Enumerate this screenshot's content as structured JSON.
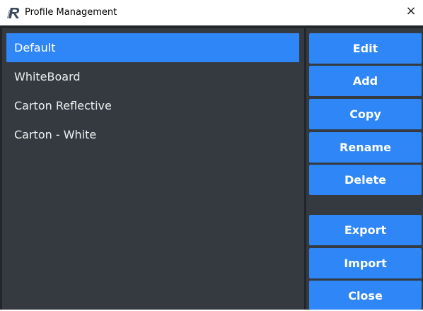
{
  "window": {
    "title": "Profile Management",
    "icon": "profile-app-icon",
    "close_glyph": "×"
  },
  "profiles": [
    {
      "label": "Default",
      "selected": true
    },
    {
      "label": "WhiteBoard",
      "selected": false
    },
    {
      "label": "Carton Reflective",
      "selected": false
    },
    {
      "label": "Carton - White",
      "selected": false
    }
  ],
  "buttons": {
    "edit": "Edit",
    "add": "Add",
    "copy": "Copy",
    "rename": "Rename",
    "delete": "Delete",
    "export": "Export",
    "import": "Import",
    "close": "Close"
  },
  "colors": {
    "accent": "#2f86f6",
    "panel": "#343a3f",
    "background": "#22262a"
  }
}
